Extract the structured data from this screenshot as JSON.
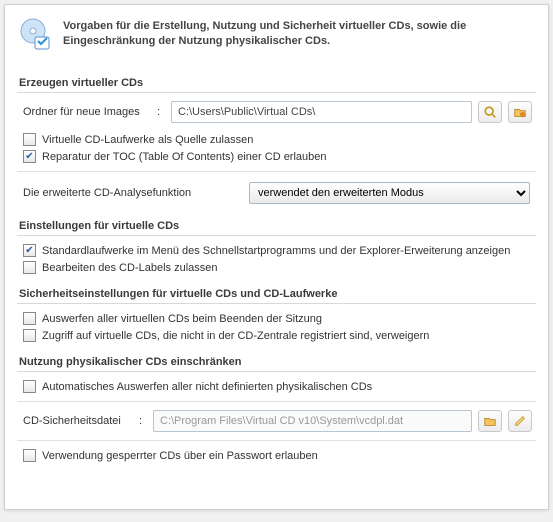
{
  "header": {
    "text": "Vorgaben für die Erstellung, Nutzung und Sicherheit virtueller CDs, sowie die Eingeschränkung der Nutzung physikalischer CDs."
  },
  "sections": {
    "create": {
      "title": "Erzeugen virtueller CDs",
      "folder_label": "Ordner für neue Images",
      "folder_value": "C:\\Users\\Public\\Virtual CDs\\",
      "allow_source_label": "Virtuelle CD-Laufwerke als Quelle zulassen",
      "allow_source_checked": false,
      "toc_repair_label": "Reparatur der TOC (Table Of Contents) einer CD erlauben",
      "toc_repair_checked": true
    },
    "analysis": {
      "label": "Die erweiterte CD-Analysefunktion",
      "selected": "verwendet den erweiterten Modus"
    },
    "vcd_settings": {
      "title": "Einstellungen für virtuelle CDs",
      "default_drives_label": "Standardlaufwerke im Menü des Schnellstartprogramms und der Explorer-Erweiterung anzeigen",
      "default_drives_checked": true,
      "edit_label_label": "Bearbeiten des CD-Labels zulassen",
      "edit_label_checked": false
    },
    "security": {
      "title": "Sicherheitseinstellungen für virtuelle CDs und CD-Laufwerke",
      "eject_all_label": "Auswerfen aller virtuellen CDs beim Beenden der Sitzung",
      "eject_all_checked": false,
      "deny_unreg_label": "Zugriff auf virtuelle CDs, die nicht in der CD-Zentrale registriert sind, verweigern",
      "deny_unreg_checked": false
    },
    "physical": {
      "title": "Nutzung physikalischer CDs einschränken",
      "auto_eject_label": "Automatisches Auswerfen aller nicht definierten physikalischen CDs",
      "auto_eject_checked": false,
      "secfile_label": "CD-Sicherheitsdatei",
      "secfile_value": "C:\\Program Files\\Virtual CD v10\\System\\vcdpl.dat"
    },
    "locked": {
      "pw_label": "Verwendung gesperrter CDs über ein Passwort erlauben",
      "pw_checked": false
    }
  }
}
